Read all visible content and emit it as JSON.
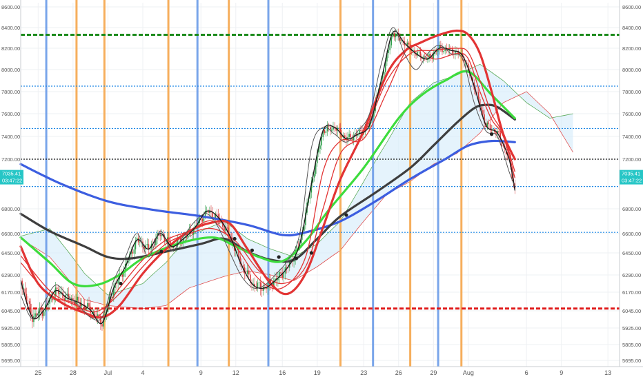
{
  "chart_data": {
    "type": "line",
    "title": "",
    "xlabel": "",
    "ylabel": "",
    "ylim": [
      5630,
      8650
    ],
    "y_ticks": [
      {
        "value": 8600,
        "label": "8600.00"
      },
      {
        "value": 8400,
        "label": "8400.00"
      },
      {
        "value": 8200,
        "label": "8200.00"
      },
      {
        "value": 8000,
        "label": "8000.00"
      },
      {
        "value": 7800,
        "label": "7800.00"
      },
      {
        "value": 7600,
        "label": "7600.00"
      },
      {
        "value": 7400,
        "label": "7400.00"
      },
      {
        "value": 7200,
        "label": "7200.00"
      },
      {
        "value": 6800,
        "label": "6800.00"
      },
      {
        "value": 6600,
        "label": "6600.00"
      },
      {
        "value": 6450,
        "label": "6450.00"
      },
      {
        "value": 6290,
        "label": "6290.00"
      },
      {
        "value": 6170,
        "label": "6170.00"
      },
      {
        "value": 6045,
        "label": "6045.00"
      },
      {
        "value": 5925,
        "label": "5925.00"
      },
      {
        "value": 5805,
        "label": "5805.00"
      },
      {
        "value": 5695,
        "label": "5695.00"
      }
    ],
    "y_scale_notes": "price axis, left and right mirrored",
    "x_ticks": [
      "25",
      "28",
      "Jul",
      "4",
      "9",
      "12",
      "16",
      "19",
      "23",
      "26",
      "29",
      "Aug",
      "6",
      "9",
      "13"
    ],
    "x_tick_days": [
      -6,
      -3,
      0,
      3,
      8,
      11,
      15,
      18,
      22,
      25,
      28,
      31,
      36,
      39,
      43
    ],
    "x_range_days": [
      -7.5,
      44
    ],
    "current_price": {
      "label": "7035.41",
      "timer": "03:47:22",
      "value": 7035.41
    },
    "horizontal_levels": [
      {
        "value": 8330,
        "style": "dashed-thick",
        "color": "#1b8a1b"
      },
      {
        "value": 7850,
        "style": "dotted",
        "color": "#1e88e5"
      },
      {
        "value": 7470,
        "style": "dotted",
        "color": "#1e88e5"
      },
      {
        "value": 7200,
        "style": "dotted",
        "color": "#111111"
      },
      {
        "value": 6980,
        "style": "dotted",
        "color": "#1e88e5"
      },
      {
        "value": 6610,
        "style": "dotted",
        "color": "#1e88e5"
      },
      {
        "value": 6060,
        "style": "dashed-thick",
        "color": "#e01b1b"
      }
    ],
    "vertical_lines": [
      {
        "day": -5.3,
        "color": "#6a9be8"
      },
      {
        "day": -2.7,
        "color": "#f5a54a"
      },
      {
        "day": -0.3,
        "color": "#f5a54a"
      },
      {
        "day": 5.2,
        "color": "#f5a54a"
      },
      {
        "day": 7.7,
        "color": "#6a9be8"
      },
      {
        "day": 10.4,
        "color": "#f5a54a"
      },
      {
        "day": 13.8,
        "color": "#6a9be8"
      },
      {
        "day": 20.0,
        "color": "#f5a54a"
      },
      {
        "day": 22.8,
        "color": "#6a9be8"
      },
      {
        "day": 26.0,
        "color": "#f5a54a"
      },
      {
        "day": 28.4,
        "color": "#6a9be8"
      },
      {
        "day": 30.4,
        "color": "#f5a54a"
      }
    ],
    "series": [
      {
        "color": "#3c5ee0",
        "width": 3.2,
        "points": [
          [
            -7.5,
            7160
          ],
          [
            -4,
            7000
          ],
          [
            0,
            6860
          ],
          [
            4,
            6790
          ],
          [
            8,
            6740
          ],
          [
            12,
            6670
          ],
          [
            15,
            6590
          ],
          [
            17,
            6610
          ],
          [
            20,
            6700
          ],
          [
            23,
            6860
          ],
          [
            26,
            7040
          ],
          [
            29,
            7200
          ],
          [
            31,
            7320
          ],
          [
            33,
            7360
          ],
          [
            35,
            7350
          ]
        ]
      },
      {
        "color": "#3e3e3e",
        "width": 3.2,
        "points": [
          [
            -7.5,
            6760
          ],
          [
            -5,
            6620
          ],
          [
            -2,
            6500
          ],
          [
            0,
            6420
          ],
          [
            2,
            6410
          ],
          [
            5,
            6460
          ],
          [
            8,
            6520
          ],
          [
            10,
            6560
          ],
          [
            12,
            6460
          ],
          [
            14,
            6400
          ],
          [
            16,
            6400
          ],
          [
            18,
            6560
          ],
          [
            20,
            6740
          ],
          [
            23,
            6930
          ],
          [
            26,
            7130
          ],
          [
            28,
            7320
          ],
          [
            30,
            7520
          ],
          [
            31.5,
            7650
          ],
          [
            32.5,
            7680
          ],
          [
            33.5,
            7660
          ],
          [
            35,
            7550
          ]
        ]
      },
      {
        "color": "#3ddc3d",
        "width": 3.2,
        "points": [
          [
            -7.5,
            6570
          ],
          [
            -5,
            6380
          ],
          [
            -3,
            6230
          ],
          [
            -1,
            6220
          ],
          [
            1,
            6290
          ],
          [
            3,
            6410
          ],
          [
            6,
            6520
          ],
          [
            9,
            6570
          ],
          [
            11,
            6500
          ],
          [
            13,
            6420
          ],
          [
            15,
            6390
          ],
          [
            17,
            6540
          ],
          [
            19,
            6790
          ],
          [
            22,
            7130
          ],
          [
            25,
            7560
          ],
          [
            27,
            7770
          ],
          [
            29,
            7900
          ],
          [
            31,
            7980
          ],
          [
            33,
            7770
          ],
          [
            35,
            7560
          ]
        ]
      },
      {
        "color": "#e23434",
        "width": 3.2,
        "points": [
          [
            -7.5,
            6500
          ],
          [
            -6,
            6230
          ],
          [
            -4,
            6100
          ],
          [
            -2,
            6030
          ],
          [
            -0.5,
            6000
          ],
          [
            1,
            6080
          ],
          [
            3,
            6300
          ],
          [
            5,
            6480
          ],
          [
            7,
            6620
          ],
          [
            9,
            6690
          ],
          [
            10.5,
            6680
          ],
          [
            12,
            6480
          ],
          [
            14,
            6230
          ],
          [
            15.5,
            6160
          ],
          [
            17,
            6300
          ],
          [
            18.5,
            6650
          ],
          [
            20,
            7040
          ],
          [
            22,
            7450
          ],
          [
            24,
            7960
          ],
          [
            25.5,
            8170
          ],
          [
            27,
            8260
          ],
          [
            28.5,
            8330
          ],
          [
            30,
            8370
          ],
          [
            31,
            8330
          ],
          [
            32,
            8150
          ],
          [
            33,
            7800
          ],
          [
            34,
            7420
          ],
          [
            35,
            7200
          ]
        ]
      },
      {
        "color": "#e23434",
        "width": 1.3,
        "points": [
          [
            -7.5,
            6430
          ],
          [
            -5,
            6180
          ],
          [
            -3,
            6090
          ],
          [
            -1,
            6040
          ],
          [
            1,
            6160
          ],
          [
            3,
            6350
          ],
          [
            5,
            6520
          ],
          [
            7,
            6600
          ],
          [
            9,
            6640
          ],
          [
            11,
            6540
          ],
          [
            13,
            6320
          ],
          [
            15,
            6230
          ],
          [
            17,
            6350
          ],
          [
            18.5,
            6800
          ],
          [
            20,
            7250
          ],
          [
            22,
            7430
          ],
          [
            24,
            7900
          ],
          [
            26,
            8150
          ],
          [
            28,
            8180
          ],
          [
            30,
            8200
          ],
          [
            31,
            8160
          ],
          [
            32,
            7900
          ],
          [
            33,
            7600
          ],
          [
            34,
            7420
          ],
          [
            35,
            7100
          ]
        ]
      },
      {
        "color": "#e23434",
        "width": 1.3,
        "points": [
          [
            -7.5,
            6380
          ],
          [
            -5,
            6150
          ],
          [
            -3,
            6100
          ],
          [
            -1,
            6000
          ],
          [
            1,
            6200
          ],
          [
            3,
            6400
          ],
          [
            5,
            6550
          ],
          [
            7,
            6620
          ],
          [
            9,
            6700
          ],
          [
            11,
            6500
          ],
          [
            13,
            6260
          ],
          [
            15,
            6200
          ],
          [
            17,
            6420
          ],
          [
            18.5,
            7100
          ],
          [
            20,
            7360
          ],
          [
            22,
            7380
          ],
          [
            24,
            7800
          ],
          [
            26,
            8220
          ],
          [
            28,
            8100
          ],
          [
            30,
            8150
          ],
          [
            31,
            8100
          ],
          [
            32,
            7800
          ],
          [
            33,
            7550
          ],
          [
            34,
            7400
          ],
          [
            35,
            7050
          ]
        ]
      },
      {
        "color": "#1d1d1d",
        "width": 1.4,
        "points": [
          [
            -7.5,
            6250
          ],
          [
            -6.5,
            6000
          ],
          [
            -5.5,
            6050
          ],
          [
            -4.5,
            6180
          ],
          [
            -3.5,
            6130
          ],
          [
            -2.5,
            6100
          ],
          [
            -1.5,
            6050
          ],
          [
            -0.5,
            5960
          ],
          [
            0.5,
            6200
          ],
          [
            1.5,
            6350
          ],
          [
            2.5,
            6550
          ],
          [
            3.5,
            6480
          ],
          [
            4.5,
            6600
          ],
          [
            5.5,
            6500
          ],
          [
            6.5,
            6560
          ],
          [
            7.5,
            6650
          ],
          [
            8.5,
            6780
          ],
          [
            9.5,
            6730
          ],
          [
            10.5,
            6580
          ],
          [
            11.5,
            6360
          ],
          [
            12.5,
            6220
          ],
          [
            13.5,
            6200
          ],
          [
            14.5,
            6260
          ],
          [
            15.5,
            6350
          ],
          [
            16.5,
            6520
          ],
          [
            17.5,
            7000
          ],
          [
            18.5,
            7450
          ],
          [
            19.5,
            7480
          ],
          [
            20.5,
            7380
          ],
          [
            21.5,
            7420
          ],
          [
            22.5,
            7500
          ],
          [
            23.5,
            7900
          ],
          [
            24.5,
            8350
          ],
          [
            25.5,
            8250
          ],
          [
            26.5,
            8150
          ],
          [
            27.5,
            8100
          ],
          [
            28.5,
            8200
          ],
          [
            29.5,
            8180
          ],
          [
            30.5,
            8130
          ],
          [
            31.5,
            7850
          ],
          [
            32.5,
            7500
          ],
          [
            33.5,
            7430
          ],
          [
            34.5,
            7200
          ],
          [
            35,
            6950
          ]
        ]
      },
      {
        "color": "#555555",
        "width": 1.0,
        "points": [
          [
            -7.5,
            6150
          ],
          [
            -6.5,
            5990
          ],
          [
            -5.5,
            6100
          ],
          [
            -4.5,
            6220
          ],
          [
            -3.5,
            6150
          ],
          [
            -2.5,
            6080
          ],
          [
            -1.5,
            6000
          ],
          [
            -0.5,
            6000
          ],
          [
            0.5,
            6250
          ],
          [
            1.5,
            6420
          ],
          [
            2.5,
            6600
          ],
          [
            3.5,
            6420
          ],
          [
            4.5,
            6620
          ],
          [
            5.5,
            6470
          ],
          [
            6.5,
            6580
          ],
          [
            7.5,
            6700
          ],
          [
            8.5,
            6760
          ],
          [
            9.5,
            6650
          ],
          [
            10.5,
            6450
          ],
          [
            11.5,
            6280
          ],
          [
            12.5,
            6200
          ],
          [
            13.5,
            6220
          ],
          [
            14.5,
            6300
          ],
          [
            15.5,
            6400
          ],
          [
            16.5,
            6600
          ],
          [
            17.5,
            7300
          ],
          [
            18.5,
            7480
          ],
          [
            19.5,
            7420
          ],
          [
            20.5,
            7350
          ],
          [
            21.5,
            7450
          ],
          [
            22.5,
            7600
          ],
          [
            23.5,
            8050
          ],
          [
            24.5,
            8400
          ],
          [
            25.5,
            8150
          ],
          [
            26.5,
            8000
          ],
          [
            27.5,
            8150
          ],
          [
            28.5,
            8230
          ],
          [
            29.5,
            8150
          ],
          [
            30.5,
            8100
          ],
          [
            31.5,
            7700
          ],
          [
            32.5,
            7450
          ],
          [
            33.5,
            7400
          ],
          [
            34.5,
            7100
          ],
          [
            35,
            6980
          ]
        ]
      }
    ],
    "cloud": {
      "span_a": [
        [
          -7.5,
          6580
        ],
        [
          -5,
          6640
        ],
        [
          -2,
          6300
        ],
        [
          0,
          6150
        ],
        [
          3,
          6230
        ],
        [
          5,
          6380
        ],
        [
          7,
          6580
        ],
        [
          10,
          6700
        ],
        [
          12,
          6560
        ],
        [
          14,
          6480
        ],
        [
          16,
          6420
        ],
        [
          18,
          6520
        ],
        [
          20,
          6700
        ],
        [
          22,
          7020
        ],
        [
          24,
          7350
        ],
        [
          26,
          7700
        ],
        [
          28,
          7880
        ],
        [
          30,
          7950
        ],
        [
          32,
          8050
        ],
        [
          34,
          7900
        ],
        [
          36,
          7700
        ],
        [
          38,
          7560
        ],
        [
          40,
          7600
        ]
      ],
      "span_b": [
        [
          -7.5,
          6560
        ],
        [
          -5,
          6420
        ],
        [
          -2,
          6120
        ],
        [
          0,
          6080
        ],
        [
          3,
          6060
        ],
        [
          5,
          6080
        ],
        [
          7,
          6200
        ],
        [
          10,
          6280
        ],
        [
          12,
          6320
        ],
        [
          14,
          6290
        ],
        [
          16,
          6250
        ],
        [
          18,
          6350
        ],
        [
          20,
          6470
        ],
        [
          22,
          6700
        ],
        [
          24,
          6920
        ],
        [
          26,
          7020
        ],
        [
          28,
          7160
        ],
        [
          30,
          7250
        ],
        [
          32,
          7430
        ],
        [
          34,
          7700
        ],
        [
          36,
          7800
        ],
        [
          38,
          7600
        ],
        [
          40,
          7260
        ]
      ]
    },
    "candles_note": "dense red/green candlesticks follow the thin black line"
  }
}
